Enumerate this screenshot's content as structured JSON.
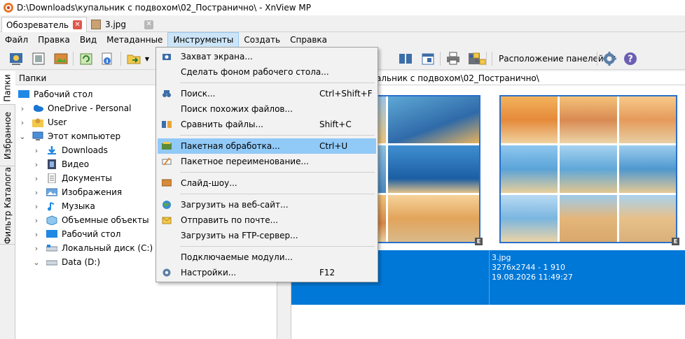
{
  "window": {
    "title": "D:\\Downloads\\купальник с подвохом\\02_Постранично\\ - XnView MP"
  },
  "tabs": [
    {
      "label": "Обозреватель",
      "active": true
    },
    {
      "label": "3.jpg",
      "active": false
    }
  ],
  "menu": [
    "Файл",
    "Правка",
    "Вид",
    "Метаданные",
    "Инструменты",
    "Создать",
    "Справка"
  ],
  "toolbar": {
    "panels_label": "Расположение панелей"
  },
  "vtabs": [
    "Папки",
    "Избранное",
    "Фильтр Каталога"
  ],
  "folders": {
    "header": "Папки",
    "items": [
      {
        "label": "Рабочий стол",
        "icon": "desktop-icon",
        "chevron": ""
      },
      {
        "label": "OneDrive - Personal",
        "icon": "cloud-icon",
        "chevron": "›"
      },
      {
        "label": "User",
        "icon": "user-icon",
        "chevron": "›"
      },
      {
        "label": "Этот компьютер",
        "icon": "computer-icon",
        "chevron": "⌄"
      },
      {
        "label": "Downloads",
        "icon": "download-icon",
        "chevron": "›"
      },
      {
        "label": "Видео",
        "icon": "video-icon",
        "chevron": "›"
      },
      {
        "label": "Документы",
        "icon": "document-icon",
        "chevron": "›"
      },
      {
        "label": "Изображения",
        "icon": "pictures-icon",
        "chevron": "›"
      },
      {
        "label": "Музыка",
        "icon": "music-icon",
        "chevron": "›"
      },
      {
        "label": "Объемные объекты",
        "icon": "3d-objects-icon",
        "chevron": "›"
      },
      {
        "label": "Рабочий стол",
        "icon": "desktop-icon",
        "chevron": "›"
      },
      {
        "label": "Локальный диск (C:)",
        "icon": "drive-icon",
        "chevron": "›"
      },
      {
        "label": "Data (D:)",
        "icon": "drive-icon",
        "chevron": "⌄"
      }
    ]
  },
  "address": {
    "path": "альник с подвохом\\02_Постранично\\"
  },
  "thumbnails": [
    {
      "name": "",
      "info": "",
      "date": "",
      "badge": "E"
    },
    {
      "name": "3.jpg",
      "info": "3276x2744 - 1 910",
      "date": "19.08.2026 11:49:27",
      "badge": "E"
    }
  ],
  "dropdown": {
    "items": [
      {
        "label": "Захват экрана...",
        "shortcut": "",
        "icon": "camera-icon",
        "highlighted": false
      },
      {
        "label": "Сделать фоном рабочего стола...",
        "shortcut": "",
        "icon": "",
        "highlighted": false
      },
      {
        "label": "Поиск...",
        "shortcut": "Ctrl+Shift+F",
        "icon": "binoculars-icon",
        "highlighted": false
      },
      {
        "label": "Поиск похожих файлов...",
        "shortcut": "",
        "icon": "",
        "highlighted": false
      },
      {
        "label": "Сравнить файлы...",
        "shortcut": "Shift+C",
        "icon": "compare-icon",
        "highlighted": false
      },
      {
        "label": "Пакетная обработка...",
        "shortcut": "Ctrl+U",
        "icon": "batch-icon",
        "highlighted": true
      },
      {
        "label": "Пакетное переименование...",
        "shortcut": "",
        "icon": "rename-icon",
        "highlighted": false
      },
      {
        "label": "Слайд-шоу...",
        "shortcut": "",
        "icon": "slideshow-icon",
        "highlighted": false
      },
      {
        "label": "Загрузить на веб-сайт...",
        "shortcut": "",
        "icon": "globe-icon",
        "highlighted": false
      },
      {
        "label": "Отправить по почте...",
        "shortcut": "",
        "icon": "mail-icon",
        "highlighted": false
      },
      {
        "label": "Загрузить на FTP-сервер...",
        "shortcut": "",
        "icon": "",
        "highlighted": false
      },
      {
        "label": "Подключаемые модули...",
        "shortcut": "",
        "icon": "",
        "highlighted": false
      },
      {
        "label": "Настройки...",
        "shortcut": "F12",
        "icon": "gear-icon",
        "highlighted": false
      }
    ]
  }
}
